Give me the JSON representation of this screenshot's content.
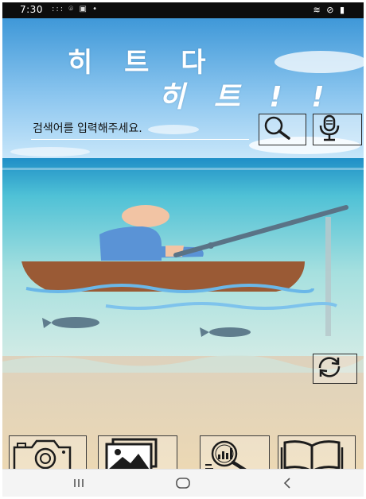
{
  "status_bar": {
    "time": "7:30",
    "notification_icons": "::: ⌾ ▣ •",
    "system_icons": "≋ ⊘ ▮"
  },
  "header": {
    "title_line1": "히 트 다",
    "title_line2": "히 트 ! !"
  },
  "search": {
    "placeholder": "검색어를 입력해주세요."
  },
  "icons": {
    "search": "magnifier-icon",
    "voice": "microphone-icon",
    "refresh": "refresh-icon",
    "camera": "camera-icon",
    "gallery": "photo-gallery-icon",
    "analysis": "chart-search-icon",
    "book": "open-book-icon"
  },
  "navigation": {
    "recents": "recent-apps-icon",
    "home": "home-icon",
    "back": "back-icon"
  },
  "colors": {
    "sky_top": "#3f98d8",
    "sea": "#7fd3d8",
    "sand": "#e8d7b8",
    "boat": "#9a5a35",
    "fisher_shirt": "#5a93d6",
    "fisher_head": "#f2c4a4",
    "fishing_rod": "#5a7386",
    "water_line": "#6ab7e8",
    "fish": "#5f7c8d"
  }
}
